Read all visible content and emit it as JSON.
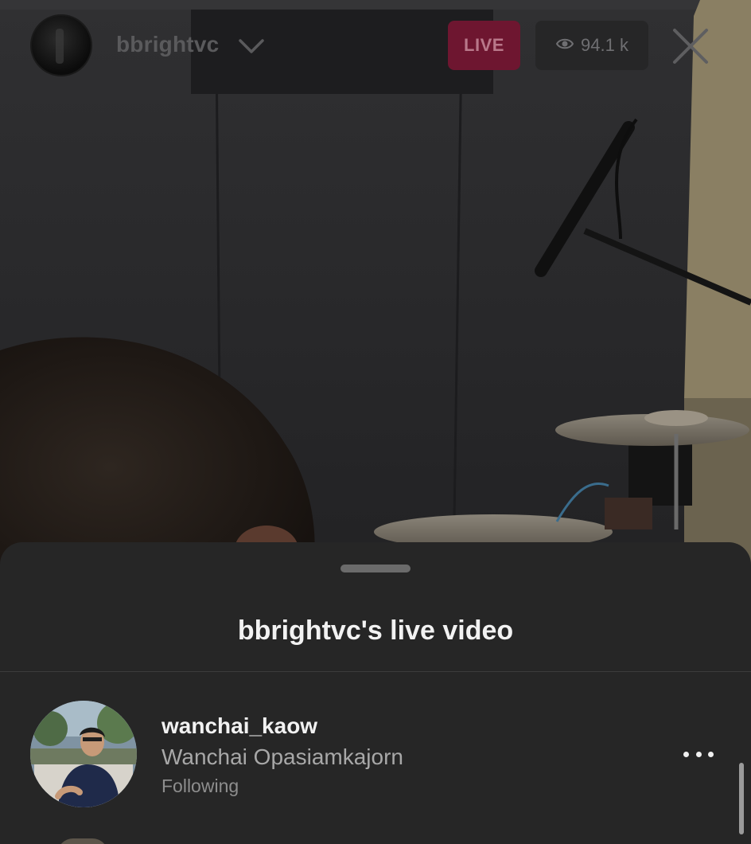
{
  "header": {
    "host_username": "bbrightvc",
    "live_label": "LIVE",
    "viewer_count": "94.1 k",
    "icons": {
      "host_avatar": "avatar",
      "dropdown": "chevron-down-icon",
      "viewers": "eye-icon",
      "close": "close-icon"
    }
  },
  "sheet": {
    "title": "bbrightvc's live video",
    "viewers": [
      {
        "username": "wanchai_kaow",
        "full_name": "Wanchai Opasiamkajorn",
        "status": "Following",
        "menu_icon": "more-horizontal-icon"
      }
    ]
  },
  "colors": {
    "live_badge_bg": "#6e1630",
    "sheet_bg": "#262626",
    "text_primary": "#f2f2f2",
    "text_secondary": "#a8a8a8"
  }
}
